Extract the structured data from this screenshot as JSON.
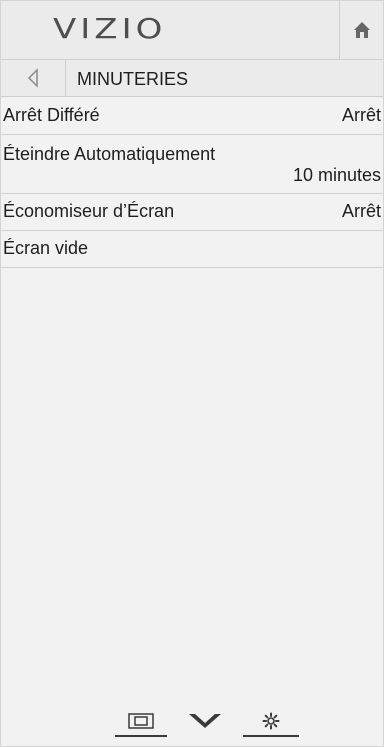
{
  "header": {
    "logo_text": "VIZIO",
    "home_icon": "home-icon"
  },
  "title_bar": {
    "back_icon": "back-arrow-icon",
    "title": "MINUTERIES"
  },
  "menu": {
    "items": [
      {
        "label": "Arrêt Différé",
        "value": "Arrêt"
      },
      {
        "label": "Éteindre Automatiquement",
        "value": "10 minutes"
      },
      {
        "label": "Économiseur d’Écran",
        "value": "Arrêt"
      },
      {
        "label": "Écran vide",
        "value": ""
      }
    ]
  },
  "footer": {
    "icons": [
      "input-icon",
      "vizio-v-icon",
      "settings-gear-icon"
    ]
  },
  "colors": {
    "background": "#f2f2f2",
    "header": "#ebebeb",
    "text": "#1e1e1e",
    "divider": "#d2d2d2"
  }
}
